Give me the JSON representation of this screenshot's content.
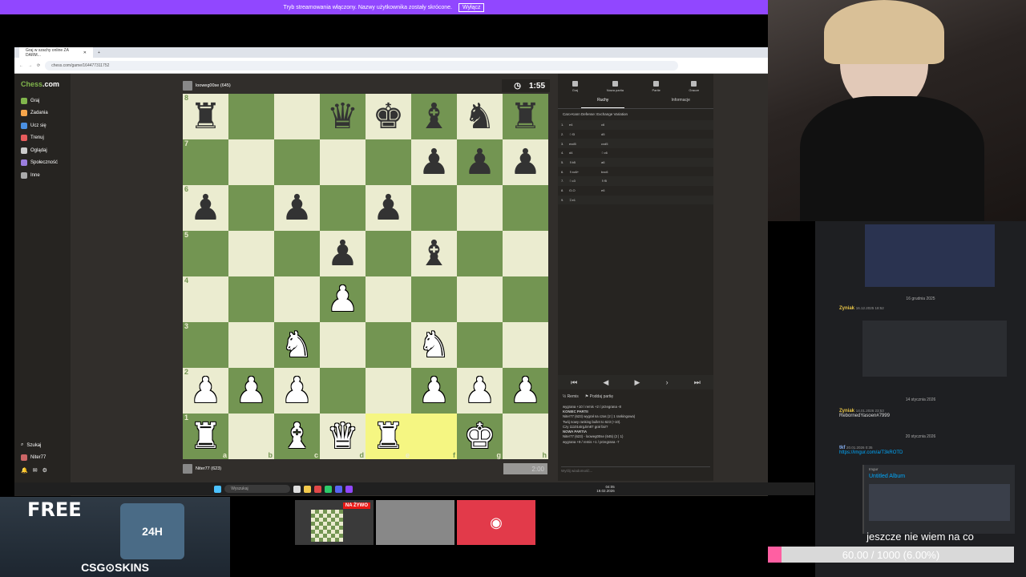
{
  "banner": {
    "text": "Tryb streamowania włączony. Nazwy użytkownika zostały skrócone.",
    "button": "Wyłącz"
  },
  "browser": {
    "tab_title": "Graj w szachy online ZA DARM...",
    "url": "chess.com/game/164477311752"
  },
  "sidebar": {
    "logo_a": "Chess",
    "logo_b": ".com",
    "items": [
      {
        "label": "Graj",
        "color": "#81b64c"
      },
      {
        "label": "Zadania",
        "color": "#f7a64b"
      },
      {
        "label": "Ucz się",
        "color": "#4a90e2"
      },
      {
        "label": "Trenuj",
        "color": "#e65c5c"
      },
      {
        "label": "Oglądaj",
        "color": "#ccc"
      },
      {
        "label": "Społeczność",
        "color": "#9b7ede"
      },
      {
        "label": "Inne",
        "color": "#aaa"
      }
    ],
    "search": "Szukaj",
    "user": "Niter77"
  },
  "top_player": {
    "name": "looweg00se (645)",
    "clock": "1:55"
  },
  "bottom_player": {
    "name": "Niter77 (623)",
    "clock": "2:00"
  },
  "board": {
    "ranks": [
      "8",
      "7",
      "6",
      "5",
      "4",
      "3",
      "2",
      "1"
    ],
    "files": [
      "a",
      "b",
      "c",
      "d",
      "e",
      "f",
      "g",
      "h"
    ],
    "rows": [
      [
        "br",
        "",
        "",
        "bq",
        "bk",
        "bb",
        "bn",
        "br"
      ],
      [
        "",
        "",
        "",
        "",
        "",
        "bp",
        "bp",
        "bp"
      ],
      [
        "bp",
        "",
        "bp",
        "",
        "bp",
        "",
        "",
        ""
      ],
      [
        "",
        "",
        "",
        "bp",
        "",
        "bb",
        "",
        ""
      ],
      [
        "",
        "",
        "",
        "wp",
        "",
        "",
        "",
        ""
      ],
      [
        "",
        "",
        "wn",
        "",
        "",
        "wn",
        "",
        ""
      ],
      [
        "wp",
        "wp",
        "wp",
        "",
        "",
        "wp",
        "wp",
        "wp"
      ],
      [
        "wr",
        "",
        "wb",
        "wq",
        "wr",
        "",
        "wk",
        ""
      ]
    ],
    "highlight": [
      "e1",
      "f1"
    ]
  },
  "right_panel": {
    "tabs": [
      "Graj",
      "Nowa partia",
      "Partie",
      "Gracze"
    ],
    "subtabs": [
      "Ruchy",
      "Informacje"
    ],
    "opening": "Caro-Kann Defense: Exchange Variation",
    "moves": [
      [
        "1.",
        "e4",
        "c6"
      ],
      [
        "2.",
        "♘f3",
        "d5"
      ],
      [
        "3.",
        "exd5",
        "cxd5"
      ],
      [
        "4.",
        "d4",
        "♘c6"
      ],
      [
        "5.",
        "♗b5",
        "a6"
      ],
      [
        "6.",
        "♗xc6+",
        "bxc6"
      ],
      [
        "7.",
        "♘c3",
        "♗f5"
      ],
      [
        "8.",
        "O-O",
        "e6"
      ],
      [
        "9.",
        "♖e1",
        ""
      ]
    ],
    "controls": [
      "⏮",
      "◀",
      "▶",
      "›",
      "⏭"
    ],
    "actions": [
      "Remis",
      "Poddaj partię"
    ],
    "chat": [
      "wygrana +10 / remis +2 / przegrana -8",
      "KONIEC PARTII",
      "Niter77 (623) wygrał na czas (2 | 1 rankingowa)",
      "Twój nowy ranking bullet to 623 (+10).",
      "Czy 11101strgJim87 grał fair?",
      "NOWA PARTIA",
      "Niter77 (623) - looweg00se (645) (2 | 1)",
      "wygrana +9 / remis +1 / przegrana -7"
    ],
    "chat_placeholder": "Wyślij wiadomość..."
  },
  "discord": {
    "dates": [
      "16 grudnia 2025",
      "14 stycznia 2026",
      "20 stycznia 2026"
    ],
    "messages": [
      {
        "user": "Zyniak",
        "time": "16.12.2025 18:52",
        "text": ""
      },
      {
        "user": "Zyniak",
        "time": "14.01.2026 23:53",
        "text": "RebornedYasoen#7999"
      },
      {
        "user": "tkf",
        "time": "20.01.2026 0:35",
        "text": "https://imgur.com/a/T3kROTD"
      }
    ],
    "embed_site": "Imgur",
    "embed_title": "Untitled Album"
  },
  "overlay": {
    "caption": "jeszcze nie wiem na co",
    "goal": "60.00 / 1000 (6.00%)",
    "goal_fraction": 0.06
  },
  "ad": {
    "free": "FREE",
    "brand": "CSG⊙SKINS",
    "badge": "24H"
  },
  "thumb": {
    "live": "NA ŻYWO"
  },
  "taskbar": {
    "search": "Wyszukaj",
    "time": "04:05",
    "date": "19.02.2026"
  },
  "colors": {
    "board_light": "#ebecd0",
    "board_dark": "#739552",
    "twitch_purple": "#9147ff",
    "discord_red": "#e23a4a"
  }
}
